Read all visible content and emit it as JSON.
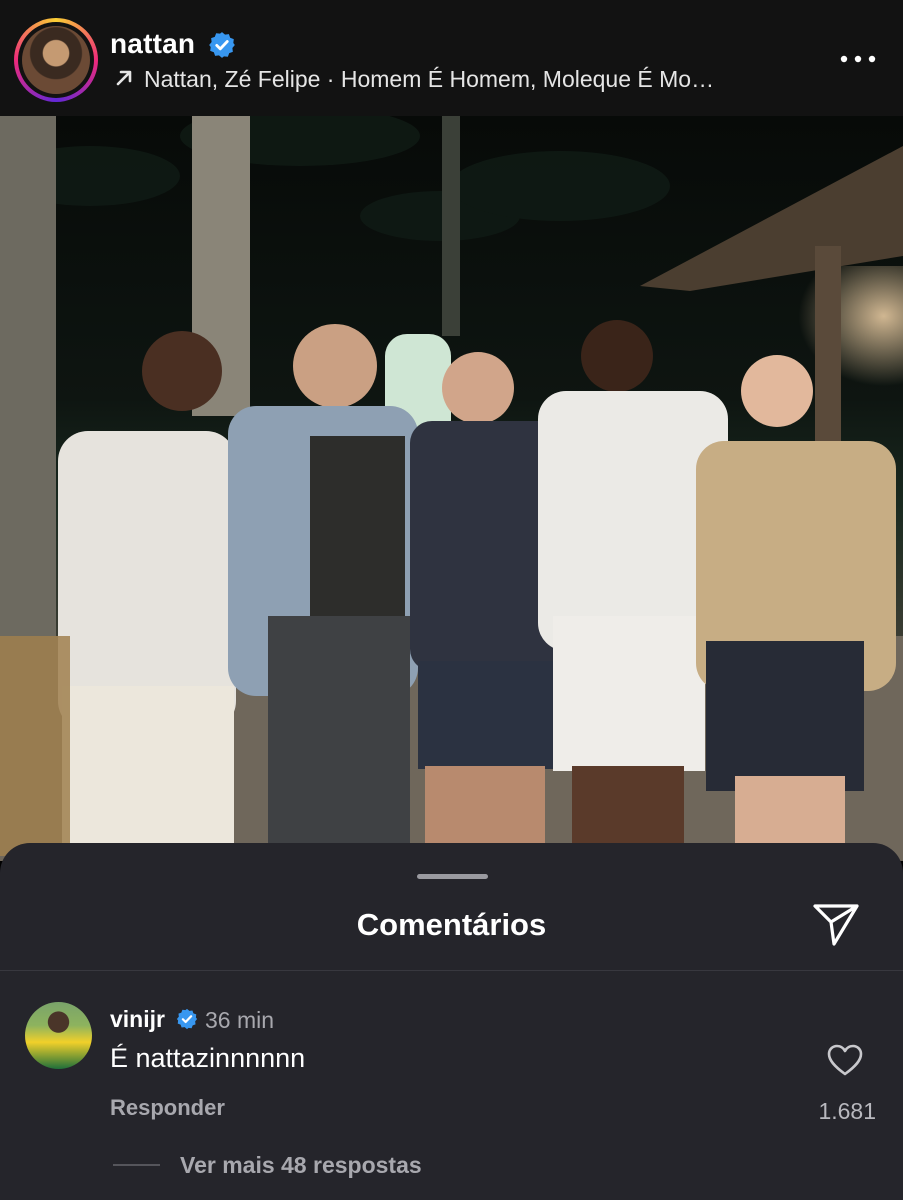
{
  "header": {
    "username": "nattan",
    "verified_icon": "verified-badge-icon",
    "music_icon": "arrow-up-right-icon",
    "music_text": "Nattan, Zé Felipe · Homem É Homem, Moleque É Mo…",
    "more_icon": "more-horizontal-icon"
  },
  "post": {
    "photo_icon": "post-photo"
  },
  "comments_sheet": {
    "title": "Comentários",
    "share_icon": "send-icon",
    "comment": {
      "username": "vinijr",
      "time": "36 min",
      "text": "É nattazinnnnnn",
      "reply_label": "Responder",
      "like_icon": "heart-icon",
      "like_count": "1.681"
    },
    "more_replies": "Ver mais 48 respostas"
  },
  "colors": {
    "header_bg": "#121212",
    "sheet_bg": "#25252b",
    "verified_blue": "#3897f0",
    "secondary_text": "#a8a8ae"
  }
}
